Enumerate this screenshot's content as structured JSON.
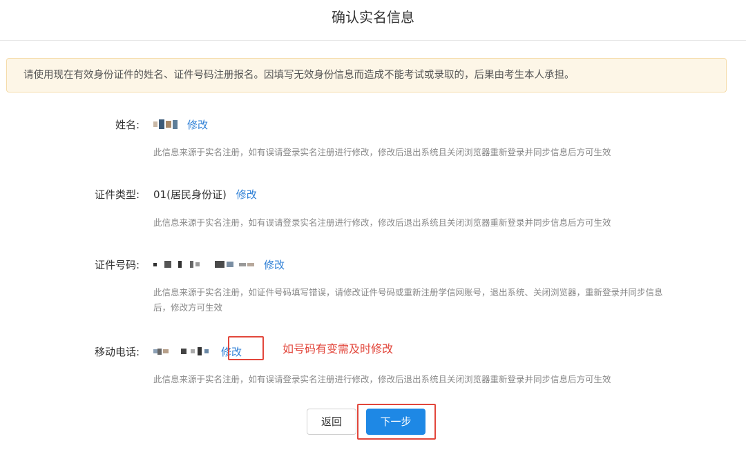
{
  "header": {
    "title": "确认实名信息"
  },
  "notice": {
    "text": "请使用现在有效身份证件的姓名、证件号码注册报名。因填写无效身份信息而造成不能考试或录取的，后果由考生本人承担。"
  },
  "fields": {
    "name": {
      "label": "姓名:",
      "edit_label": "修改",
      "hint": "此信息来源于实名注册，如有误请登录实名注册进行修改，修改后退出系统且关闭浏览器重新登录并同步信息后方可生效"
    },
    "id_type": {
      "label": "证件类型:",
      "value": "01(居民身份证)",
      "edit_label": "修改",
      "hint": "此信息来源于实名注册，如有误请登录实名注册进行修改，修改后退出系统且关闭浏览器重新登录并同步信息后方可生效"
    },
    "id_number": {
      "label": "证件号码:",
      "edit_label": "修改",
      "hint_line1": "此信息来源于实名注册，如证件号码填写错误，请修改证件号码或重新注册学信网账号，退出系统、关闭浏览器，重新登录并同步信息",
      "hint_line2": "后，修改方可生效"
    },
    "mobile": {
      "label": "移动电话:",
      "edit_label": "修改",
      "hint": "此信息来源于实名注册，如有误请登录实名注册进行修改，修改后退出系统且关闭浏览器重新登录并同步信息后方可生效"
    }
  },
  "annotation": {
    "text": "如号码有变需及时修改"
  },
  "buttons": {
    "back_label": "返回",
    "next_label": "下一步"
  },
  "colors": {
    "link": "#2d7fd6",
    "primary": "#1e88e5",
    "highlight": "#e2463b",
    "notice_bg": "#fdf6e7"
  }
}
